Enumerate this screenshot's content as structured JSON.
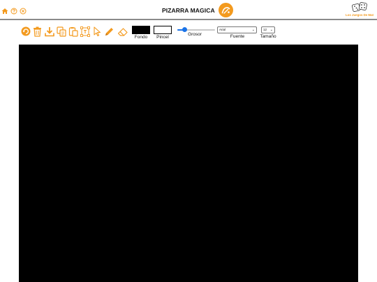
{
  "header": {
    "title": "PIZARRA MAGICA",
    "brand": "Los Juegos De Mat",
    "left_icons": [
      "home-icon",
      "help-circle-icon",
      "close-circle-icon"
    ]
  },
  "toolbar": {
    "tools": [
      "undo-icon",
      "trash-icon",
      "download-icon",
      "copy-icon",
      "paste-icon",
      "text-frame-icon",
      "pointer-icon",
      "pencil-icon",
      "eraser-icon"
    ],
    "background_label": "Fondo",
    "background_color": "#000000",
    "brush_label": "Pincel",
    "brush_color": "#ffffff",
    "thickness_label": "Grosor",
    "thickness_level": 0.15,
    "font_label": "Fuente",
    "font_value": "Arial",
    "size_label": "Tamaño",
    "size_value": "12"
  },
  "colors": {
    "accent": "#f39a1e",
    "slider": "#1a73e8",
    "canvas": "#000000"
  }
}
